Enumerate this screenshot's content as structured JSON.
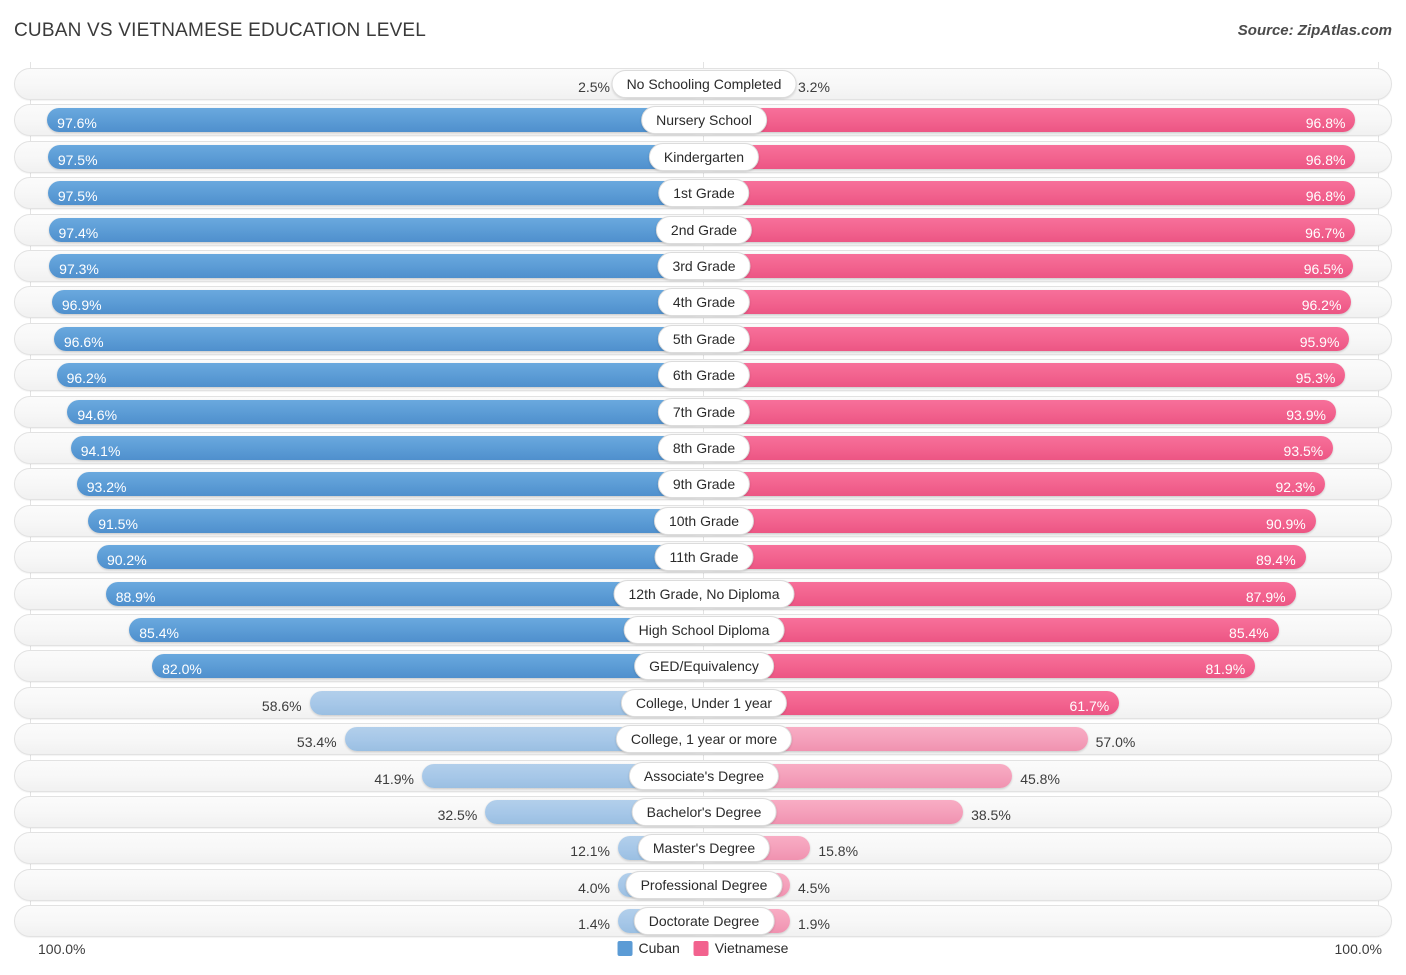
{
  "header": {
    "title": "CUBAN VS VIETNAMESE EDUCATION LEVEL",
    "source": "Source: ZipAtlas.com"
  },
  "legend": {
    "items": [
      {
        "label": "Cuban",
        "color": "#5b9bd5"
      },
      {
        "label": "Vietnamese",
        "color": "#f2628e"
      }
    ]
  },
  "axis": {
    "left_label": "100.0%",
    "right_label": "100.0%",
    "max": 100.0
  },
  "colors": {
    "left_high": "#5b9bd5",
    "left_low": "#a6c7e8",
    "right_high": "#f2628e",
    "right_low": "#f49fba",
    "track": "#f7f7f7",
    "gridline": "#e3e3e3"
  },
  "chart_data": {
    "type": "bar",
    "orientation": "diverging-horizontal",
    "title": "CUBAN VS VIETNAMESE EDUCATION LEVEL",
    "xlabel": "",
    "ylabel": "",
    "xlim": [
      0,
      100
    ],
    "grid": true,
    "legend_position": "bottom-center",
    "series": [
      {
        "name": "Cuban",
        "side": "left",
        "color": "#5b9bd5",
        "values": [
          2.5,
          97.6,
          97.5,
          97.5,
          97.4,
          97.3,
          96.9,
          96.6,
          96.2,
          94.6,
          94.1,
          93.2,
          91.5,
          90.2,
          88.9,
          85.4,
          82.0,
          58.6,
          53.4,
          41.9,
          32.5,
          12.1,
          4.0,
          1.4
        ]
      },
      {
        "name": "Vietnamese",
        "side": "right",
        "color": "#f2628e",
        "values": [
          3.2,
          96.8,
          96.8,
          96.8,
          96.7,
          96.5,
          96.2,
          95.9,
          95.3,
          93.9,
          93.5,
          92.3,
          90.9,
          89.4,
          87.9,
          85.4,
          81.9,
          61.7,
          57.0,
          45.8,
          38.5,
          15.8,
          4.5,
          1.9
        ]
      }
    ],
    "categories": [
      "No Schooling Completed",
      "Nursery School",
      "Kindergarten",
      "1st Grade",
      "2nd Grade",
      "3rd Grade",
      "4th Grade",
      "5th Grade",
      "6th Grade",
      "7th Grade",
      "8th Grade",
      "9th Grade",
      "10th Grade",
      "11th Grade",
      "12th Grade, No Diploma",
      "High School Diploma",
      "GED/Equivalency",
      "College, Under 1 year",
      "College, 1 year or more",
      "Associate's Degree",
      "Bachelor's Degree",
      "Master's Degree",
      "Professional Degree",
      "Doctorate Degree"
    ]
  },
  "rows": [
    {
      "category": "No Schooling Completed",
      "left_text": "2.5%",
      "right_text": "3.2%",
      "left": 2.5,
      "right": 3.2
    },
    {
      "category": "Nursery School",
      "left_text": "97.6%",
      "right_text": "96.8%",
      "left": 97.6,
      "right": 96.8
    },
    {
      "category": "Kindergarten",
      "left_text": "97.5%",
      "right_text": "96.8%",
      "left": 97.5,
      "right": 96.8
    },
    {
      "category": "1st Grade",
      "left_text": "97.5%",
      "right_text": "96.8%",
      "left": 97.5,
      "right": 96.8
    },
    {
      "category": "2nd Grade",
      "left_text": "97.4%",
      "right_text": "96.7%",
      "left": 97.4,
      "right": 96.7
    },
    {
      "category": "3rd Grade",
      "left_text": "97.3%",
      "right_text": "96.5%",
      "left": 97.3,
      "right": 96.5
    },
    {
      "category": "4th Grade",
      "left_text": "96.9%",
      "right_text": "96.2%",
      "left": 96.9,
      "right": 96.2
    },
    {
      "category": "5th Grade",
      "left_text": "96.6%",
      "right_text": "95.9%",
      "left": 96.6,
      "right": 95.9
    },
    {
      "category": "6th Grade",
      "left_text": "96.2%",
      "right_text": "95.3%",
      "left": 96.2,
      "right": 95.3
    },
    {
      "category": "7th Grade",
      "left_text": "94.6%",
      "right_text": "93.9%",
      "left": 94.6,
      "right": 93.9
    },
    {
      "category": "8th Grade",
      "left_text": "94.1%",
      "right_text": "93.5%",
      "left": 94.1,
      "right": 93.5
    },
    {
      "category": "9th Grade",
      "left_text": "93.2%",
      "right_text": "92.3%",
      "left": 93.2,
      "right": 92.3
    },
    {
      "category": "10th Grade",
      "left_text": "91.5%",
      "right_text": "90.9%",
      "left": 91.5,
      "right": 90.9
    },
    {
      "category": "11th Grade",
      "left_text": "90.2%",
      "right_text": "89.4%",
      "left": 90.2,
      "right": 89.4
    },
    {
      "category": "12th Grade, No Diploma",
      "left_text": "88.9%",
      "right_text": "87.9%",
      "left": 88.9,
      "right": 87.9
    },
    {
      "category": "High School Diploma",
      "left_text": "85.4%",
      "right_text": "85.4%",
      "left": 85.4,
      "right": 85.4
    },
    {
      "category": "GED/Equivalency",
      "left_text": "82.0%",
      "right_text": "81.9%",
      "left": 82.0,
      "right": 81.9
    },
    {
      "category": "College, Under 1 year",
      "left_text": "58.6%",
      "right_text": "61.7%",
      "left": 58.6,
      "right": 61.7
    },
    {
      "category": "College, 1 year or more",
      "left_text": "53.4%",
      "right_text": "57.0%",
      "left": 53.4,
      "right": 57.0
    },
    {
      "category": "Associate's Degree",
      "left_text": "41.9%",
      "right_text": "45.8%",
      "left": 41.9,
      "right": 45.8
    },
    {
      "category": "Bachelor's Degree",
      "left_text": "32.5%",
      "right_text": "38.5%",
      "left": 32.5,
      "right": 38.5
    },
    {
      "category": "Master's Degree",
      "left_text": "12.1%",
      "right_text": "15.8%",
      "left": 12.1,
      "right": 15.8
    },
    {
      "category": "Professional Degree",
      "left_text": "4.0%",
      "right_text": "4.5%",
      "left": 4.0,
      "right": 4.5
    },
    {
      "category": "Doctorate Degree",
      "left_text": "1.4%",
      "right_text": "1.9%",
      "left": 1.4,
      "right": 1.9
    }
  ]
}
